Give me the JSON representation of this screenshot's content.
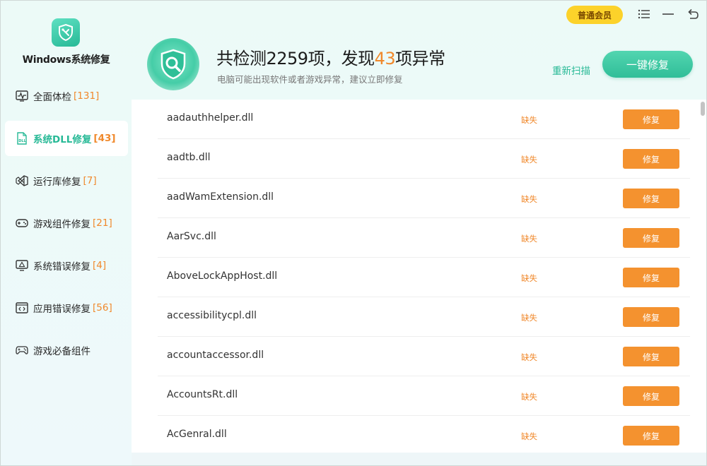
{
  "app": {
    "title": "Windows系统修复"
  },
  "sidebar": {
    "items": [
      {
        "label": "全面体检",
        "count": "[131]",
        "icon": "pulse-icon",
        "active": false
      },
      {
        "label": "系统DLL修复",
        "count": "[43]",
        "icon": "dll-file-icon",
        "active": true
      },
      {
        "label": "运行库修复",
        "count": "[7]",
        "icon": "visual-studio-icon",
        "active": false
      },
      {
        "label": "游戏组件修复",
        "count": "[21]",
        "icon": "gamepad-icon",
        "active": false
      },
      {
        "label": "系统错误修复",
        "count": "[4]",
        "icon": "monitor-warning-icon",
        "active": false
      },
      {
        "label": "应用错误修复",
        "count": "[56]",
        "icon": "code-window-icon",
        "active": false
      },
      {
        "label": "游戏必备组件",
        "count": "",
        "icon": "controller-icon",
        "active": false
      }
    ]
  },
  "titlebar": {
    "member_label": "普通会员",
    "icons": [
      "menu-icon",
      "minimize-icon",
      "back-icon"
    ]
  },
  "header": {
    "title_prefix": "共检测2259项，发现",
    "title_highlight": "43",
    "title_suffix": "项异常",
    "subtitle": "电脑可能出现软件或者游戏异常，建议立即修复",
    "rescan_label": "重新扫描",
    "fix_all_label": "一键修复"
  },
  "list": {
    "rows": [
      {
        "name": "aadauthhelper.dll",
        "status": "缺失",
        "action": "修复"
      },
      {
        "name": "aadtb.dll",
        "status": "缺失",
        "action": "修复"
      },
      {
        "name": "aadWamExtension.dll",
        "status": "缺失",
        "action": "修复"
      },
      {
        "name": "AarSvc.dll",
        "status": "缺失",
        "action": "修复"
      },
      {
        "name": "AboveLockAppHost.dll",
        "status": "缺失",
        "action": "修复"
      },
      {
        "name": "accessibilitycpl.dll",
        "status": "缺失",
        "action": "修复"
      },
      {
        "name": "accountaccessor.dll",
        "status": "缺失",
        "action": "修复"
      },
      {
        "name": "AccountsRt.dll",
        "status": "缺失",
        "action": "修复"
      },
      {
        "name": "AcGenral.dll",
        "status": "缺失",
        "action": "修复"
      }
    ]
  },
  "colors": {
    "accent": "#27b996",
    "warning": "#f0892c",
    "fix_button": "#f4922f",
    "member_badge": "#fcd22a"
  }
}
